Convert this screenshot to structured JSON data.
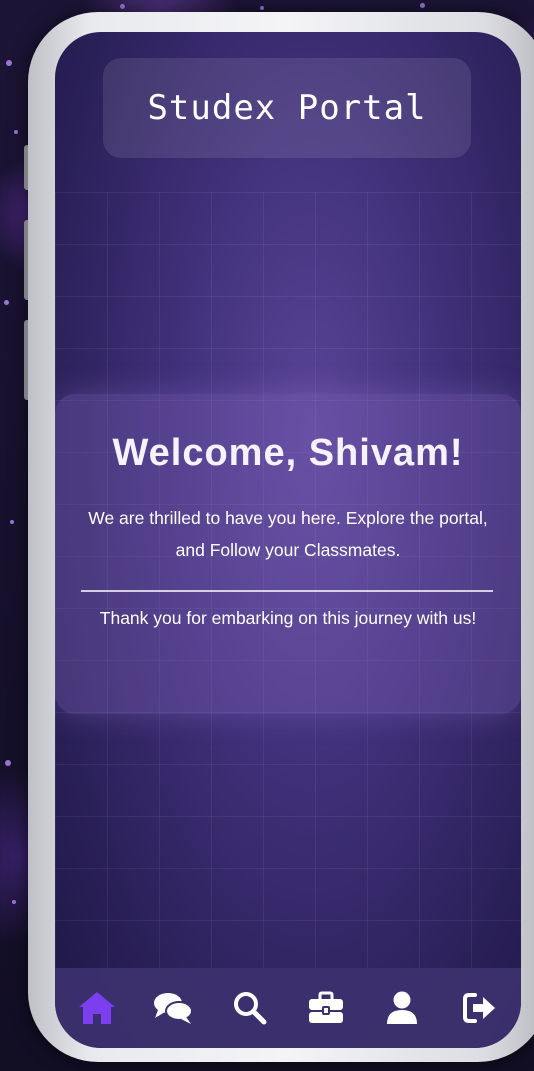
{
  "app": {
    "title": "Studex Portal"
  },
  "welcome": {
    "heading": "Welcome, Shivam!",
    "message": "We are thrilled to have you here. Explore the portal, and Follow your Classmates.",
    "thanks": "Thank you for embarking on this journey with us!"
  },
  "nav": {
    "items": [
      {
        "icon": "home-icon",
        "active": true
      },
      {
        "icon": "chat-icon",
        "active": false
      },
      {
        "icon": "search-icon",
        "active": false
      },
      {
        "icon": "briefcase-icon",
        "active": false
      },
      {
        "icon": "user-icon",
        "active": false
      },
      {
        "icon": "logout-icon",
        "active": false
      }
    ],
    "active_color": "#7b3ff0",
    "icon_color": "#ffffff"
  },
  "colors": {
    "screen_bg": "#3f2f78",
    "card_bg": "#6a55a8"
  }
}
